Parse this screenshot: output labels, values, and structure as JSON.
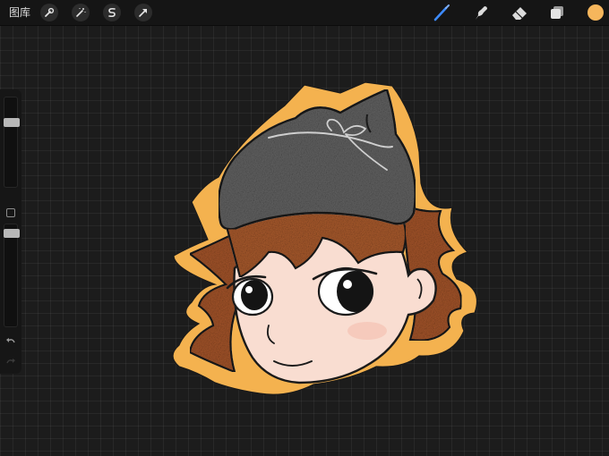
{
  "topbar": {
    "gallery_label": "图库",
    "left_tools": [
      {
        "name": "wrench-icon"
      },
      {
        "name": "magic-wand-icon"
      },
      {
        "name": "selection-s-icon"
      },
      {
        "name": "transform-arrow-icon"
      }
    ],
    "right_tools": [
      {
        "name": "brush-icon",
        "active_color": "#3d8bff"
      },
      {
        "name": "smudge-icon"
      },
      {
        "name": "eraser-icon"
      },
      {
        "name": "layers-icon"
      }
    ],
    "current_color": "#f6b65c"
  },
  "sidebar": {
    "brush_size": 0.25,
    "opacity": 0.95
  },
  "colors": {
    "canvas_bg": "#1c1c1c",
    "outline": "#f4b24f",
    "hat": "#5f5f5f",
    "hair": "#9c4f27",
    "skin": "#f8dcd0"
  }
}
